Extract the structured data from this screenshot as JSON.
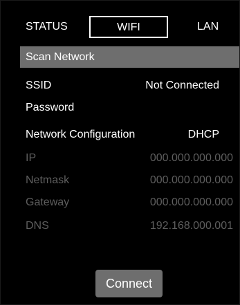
{
  "tabs": {
    "status": "STATUS",
    "wifi": "WIFI",
    "lan": "LAN",
    "selected": "WIFI"
  },
  "scan": {
    "label": "Scan Network"
  },
  "fields": {
    "ssid": {
      "label": "SSID",
      "value": "Not Connected"
    },
    "password": {
      "label": "Password",
      "value": ""
    },
    "network_configuration": {
      "label": "Network Configuration",
      "value": "DHCP"
    },
    "ip": {
      "label": "IP",
      "value": "000.000.000.000"
    },
    "netmask": {
      "label": "Netmask",
      "value": "000.000.000.000"
    },
    "gateway": {
      "label": "Gateway",
      "value": "000.000.000.000"
    },
    "dns": {
      "label": "DNS",
      "value": "192.168.000.001"
    }
  },
  "connect": {
    "label": "Connect"
  },
  "colors": {
    "background": "#000000",
    "text": "#ffffff",
    "disabled_text": "#5e5e5e",
    "highlight": "#6e6e6e"
  }
}
